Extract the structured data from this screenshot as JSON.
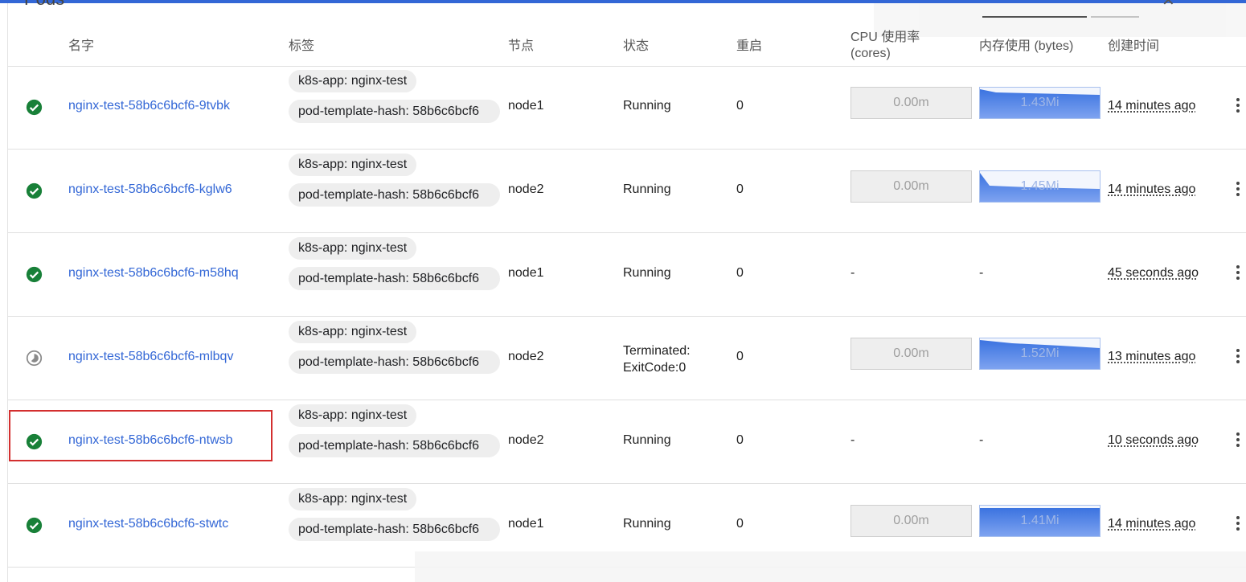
{
  "page_title": "Pods",
  "columns": [
    "名字",
    "标签",
    "节点",
    "状态",
    "重启",
    "CPU 使用率",
    "(cores)",
    "内存使用 (bytes)",
    "创建时间"
  ],
  "colors": {
    "link": "#3367d6",
    "ok": "#188038",
    "highlight": "#d32f2f",
    "memory": "#4a80e8"
  },
  "pods": [
    {
      "icon": "success",
      "name": "nginx-test-58b6c6bcf6-9tvbk",
      "label_app": "k8s-app: nginx-test",
      "label_hash": "pod-template-hash: 58b6c6bcf6",
      "node": "node1",
      "status": "Running",
      "restarts": "0",
      "cpu": "0.00m",
      "memory": "1.43Mi",
      "created": "14 minutes ago",
      "cpu_shown": true,
      "mem_shape": "slight"
    },
    {
      "icon": "success",
      "name": "nginx-test-58b6c6bcf6-kglw6",
      "label_app": "k8s-app: nginx-test",
      "label_hash": "pod-template-hash: 58b6c6bcf6",
      "node": "node2",
      "status": "Running",
      "restarts": "0",
      "cpu": "0.00m",
      "memory": "1.45Mi",
      "created": "14 minutes ago",
      "cpu_shown": true,
      "mem_shape": "drop"
    },
    {
      "icon": "success",
      "name": "nginx-test-58b6c6bcf6-m58hq",
      "label_app": "k8s-app: nginx-test",
      "label_hash": "pod-template-hash: 58b6c6bcf6",
      "node": "node1",
      "status": "Running",
      "restarts": "0",
      "cpu": "-",
      "memory": "-",
      "created": "45 seconds ago",
      "cpu_shown": false,
      "mem_shape": "none"
    },
    {
      "icon": "terminated",
      "name": "nginx-test-58b6c6bcf6-mlbqv",
      "label_app": "k8s-app: nginx-test",
      "label_hash": "pod-template-hash: 58b6c6bcf6",
      "node": "node2",
      "status_line1": "Terminated:",
      "status_line2": "ExitCode:0",
      "restarts": "0",
      "cpu": "0.00m",
      "memory": "1.52Mi",
      "created": "13 minutes ago",
      "cpu_shown": true,
      "mem_shape": "slope"
    },
    {
      "icon": "success",
      "name": "nginx-test-58b6c6bcf6-ntwsb",
      "label_app": "k8s-app: nginx-test",
      "label_hash": "pod-template-hash: 58b6c6bcf6",
      "node": "node2",
      "status": "Running",
      "restarts": "0",
      "cpu": "-",
      "memory": "-",
      "created": "10 seconds ago",
      "cpu_shown": false,
      "mem_shape": "none"
    },
    {
      "icon": "success",
      "name": "nginx-test-58b6c6bcf6-stwtc",
      "label_app": "k8s-app: nginx-test",
      "label_hash": "pod-template-hash: 58b6c6bcf6",
      "node": "node1",
      "status": "Running",
      "restarts": "0",
      "cpu": "0.00m",
      "memory": "1.41Mi",
      "created": "14 minutes ago",
      "cpu_shown": true,
      "mem_shape": "flat"
    }
  ]
}
